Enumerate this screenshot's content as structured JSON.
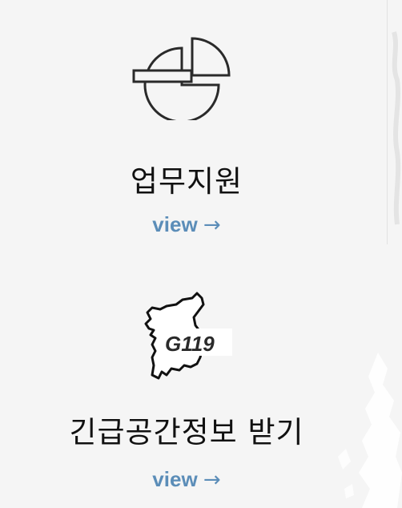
{
  "cards": [
    {
      "title": "업무지원",
      "link_label": "view",
      "link_arrow": "→",
      "icon": "pie-chart-icon"
    },
    {
      "title": "긴급공간정보 받기",
      "link_label": "view",
      "link_arrow": "→",
      "icon": "korea-map-g119-icon",
      "icon_text": "G119"
    }
  ],
  "colors": {
    "background": "#f5f5f5",
    "title": "#111111",
    "link": "#5b8db8",
    "icon_stroke": "#2a2a2a"
  }
}
